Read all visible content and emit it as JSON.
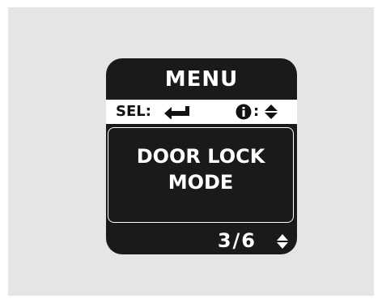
{
  "menu": {
    "title": "MENU"
  },
  "selbar": {
    "sel_label": "SEL:",
    "enter_icon": "enter-arrow-icon",
    "info_icon": "info-icon",
    "info_separator": ":",
    "scroll_icon": "up-down-arrow-icon"
  },
  "content": {
    "line1": "DOOR LOCK",
    "line2": "MODE"
  },
  "footer": {
    "page": "3/6",
    "scroll_icon": "up-down-arrow-icon"
  },
  "colors": {
    "background_panel": "#e4e5e7",
    "display": "#1a1a1a",
    "text_light": "#ffffff",
    "bar": "#ffffff"
  }
}
